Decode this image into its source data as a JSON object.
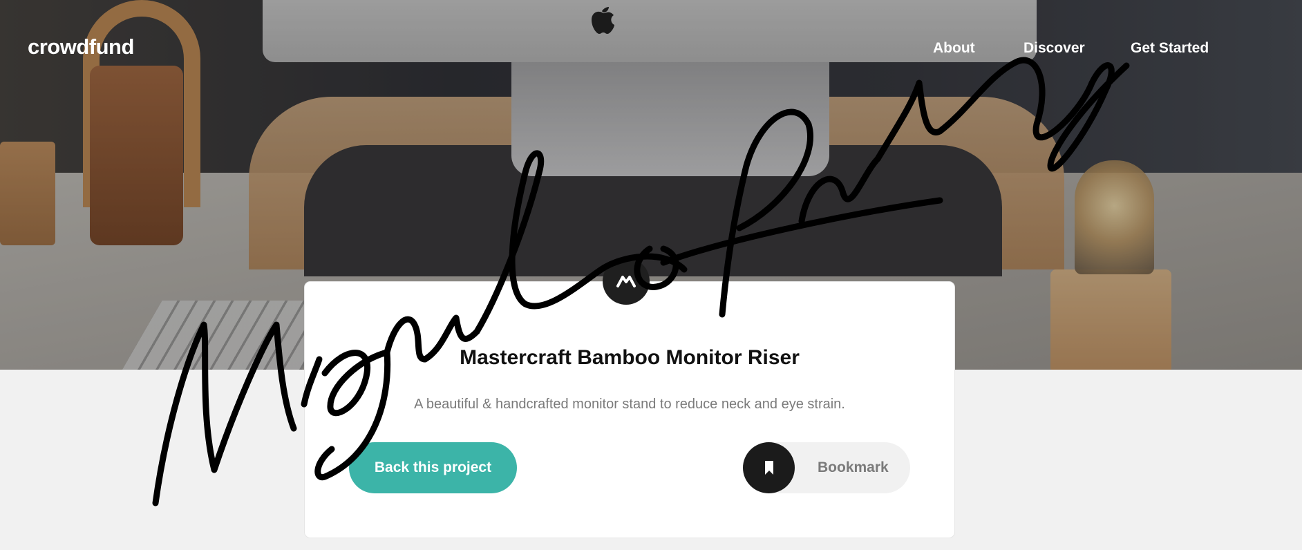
{
  "header": {
    "logo": "crowdfund",
    "nav": [
      "About",
      "Discover",
      "Get Started"
    ]
  },
  "hero": {
    "image_alt": "desk with monitor on bamboo riser"
  },
  "project": {
    "title": "Mastercraft Bamboo Monitor Riser",
    "description": "A beautiful & handcrafted monitor stand to reduce neck and eye strain.",
    "back_label": "Back this project",
    "bookmark_label": "Bookmark"
  },
  "overlay": {
    "signature": "Miguelo Ramos"
  },
  "colors": {
    "accent": "#3cb4a8",
    "dark": "#1b1b1b",
    "background": "#f1f1f1"
  },
  "icons": {
    "brand": "mastercraft-logo-icon",
    "bookmark": "bookmark-icon",
    "apple": "apple-logo-icon"
  }
}
